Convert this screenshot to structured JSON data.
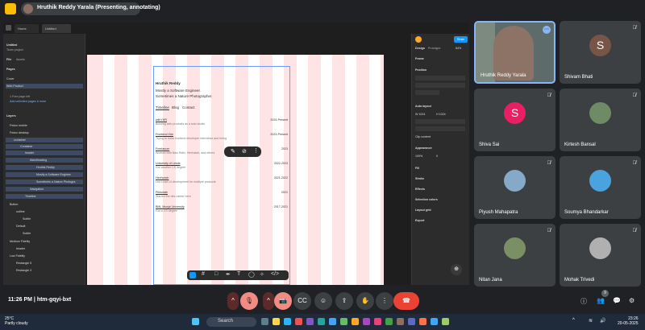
{
  "presenting": "Hruthik Reddy Yarala (Presenting, annotating)",
  "figma": {
    "tabs": [
      "Home",
      "Untitled"
    ],
    "file_name": "Untitled",
    "team": "Team project",
    "nav_tabs": [
      "File",
      "Assets"
    ],
    "pages_label": "Pages",
    "pages": [
      "Cover",
      "Web Product"
    ],
    "free_plan": "1 Free page left",
    "unlimited": "Add unlimited pages & more",
    "layers_label": "Layers",
    "layers": [
      "Fedox mobile",
      "Fedox desktop",
      "container",
      "Container",
      "header",
      "MainHeading",
      "Hruthik Reddy",
      "Mostly a Software Enginee",
      "Sometimes a Nature Photogra",
      "Navigation",
      "Timeline",
      "Button",
      "outline",
      "Subtle",
      "Default",
      "Subtle",
      "Medium Fidelity",
      "header",
      "Low Fidelity",
      "Rectangle 5",
      "Rectangle 3"
    ],
    "canvas": {
      "name": "Hruthik Reddy",
      "line1": "Mostly a Software Engineer.",
      "line2": "Sometimes a Nature Photographer.",
      "nav": [
        "Timeline",
        "Blog",
        "Contact"
      ],
      "entries": [
        {
          "title": "withYHR",
          "desc": "Building web products as a solo studio",
          "date": "2024-Present"
        },
        {
          "title": "Frontend Hire",
          "desc": "Trying to solve frontend developer interviews and hiring",
          "date": "2023-Present"
        },
        {
          "title": "Freelancer",
          "desc": "Worked with New Relic, Hirehatch, and others",
          "date": "2023"
        },
        {
          "title": "University of Leeds",
          "desc": "Got another CS degree",
          "date": "2022-2023"
        },
        {
          "title": "Hirehunch",
          "desc": "Led Lead UI development for multiple products",
          "date": "2021-2022"
        },
        {
          "title": "Pikturiate",
          "desc": "Started the dev career here",
          "date": "2021"
        },
        {
          "title": "BML Munjal University",
          "desc": "Got a CS degree",
          "date": "2017-2021"
        }
      ]
    },
    "right": {
      "share": "Share",
      "tabs": [
        "Design",
        "Prototype"
      ],
      "zoom": "84%",
      "frame": "Frame",
      "sections": [
        "Position",
        "Auto layout",
        "Appearance",
        "Fill",
        "Stroke",
        "Effects",
        "Selection colors",
        "Layout grid",
        "Export"
      ],
      "w": "W 1024",
      "h": "H 1024",
      "clip": "Clip content",
      "opacity": "100%",
      "radius": "0"
    }
  },
  "participants": [
    {
      "name": "Hruthik Reddy Yarala",
      "initial": ""
    },
    {
      "name": "Shivam Bhati",
      "initial": "S",
      "color": "#795548"
    },
    {
      "name": "Shiva Sai",
      "initial": "S",
      "color": "#e91e63"
    },
    {
      "name": "Kirtesh Bansal",
      "initial": "",
      "color": "#6d8c66"
    },
    {
      "name": "Piyush Mahapatra",
      "initial": "",
      "color": "#86a9c9"
    },
    {
      "name": "Soumya Bhandarkar",
      "initial": "",
      "color": "#4aa3df"
    },
    {
      "name": "Nitan Jana",
      "initial": "",
      "color": "#7a8f63"
    },
    {
      "name": "Mohak Trivedi",
      "initial": "",
      "color": "#b0b0b0"
    }
  ],
  "meeting": {
    "time": "11:26 PM",
    "code": "htm-gqyi-bxt",
    "count": "9"
  },
  "taskbar": {
    "temp": "25°C",
    "weather": "Partly cloudy",
    "search": "Search",
    "clock": "23:26",
    "date": "20-05-2025"
  }
}
